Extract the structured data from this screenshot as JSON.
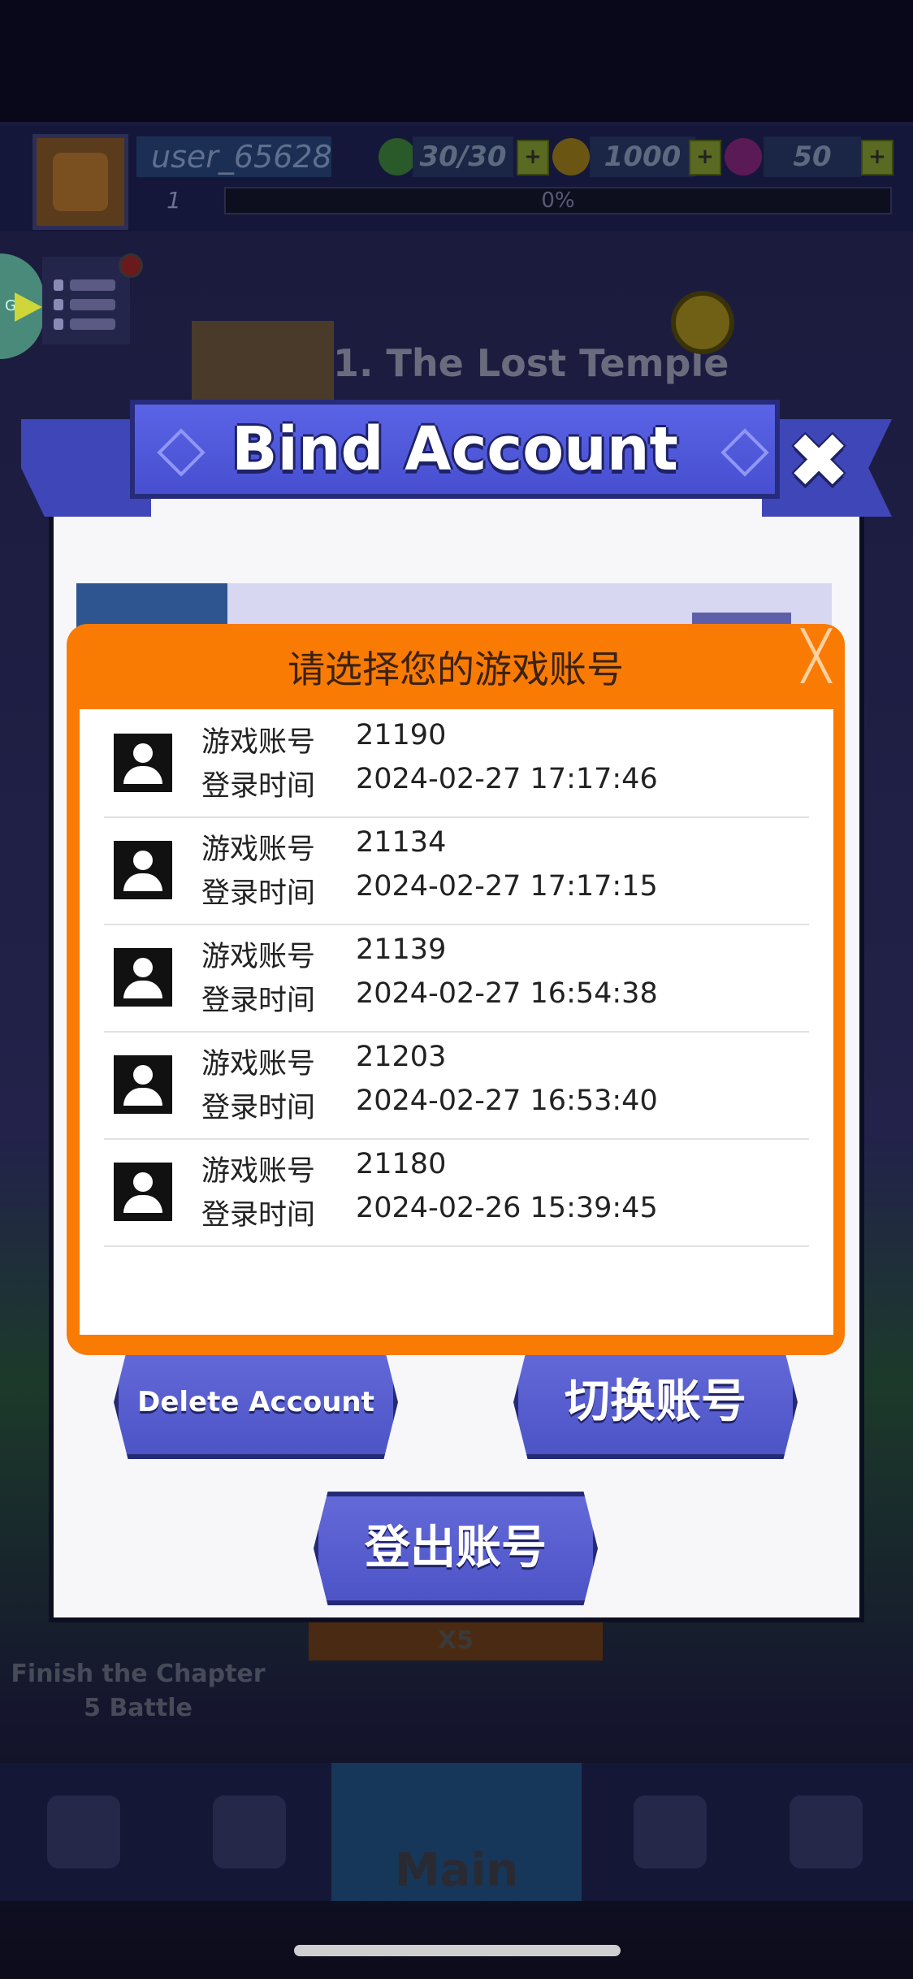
{
  "hud": {
    "username": "user_65628",
    "level": "1",
    "xp_percent": "0%",
    "energy": "30/30",
    "coins": "1000",
    "gems": "50",
    "gm_label": "GM",
    "chapter_title": "1. The Lost Temple",
    "mission_text": "Finish the Chapter 5 Battle",
    "reward_multiplier": "X5",
    "main_tab": "Main"
  },
  "bind_panel": {
    "title": "Bind Account",
    "delete_button": "Delete Account",
    "switch_button": "切换账号",
    "logout_button": "登出账号"
  },
  "popup": {
    "title": "请选择您的游戏账号",
    "account_label": "游戏账号",
    "login_time_label": "登录时间",
    "accounts": [
      {
        "id": "21190",
        "login_time": "2024-02-27 17:17:46"
      },
      {
        "id": "21134",
        "login_time": "2024-02-27 17:17:15"
      },
      {
        "id": "21139",
        "login_time": "2024-02-27 16:54:38"
      },
      {
        "id": "21203",
        "login_time": "2024-02-27 16:53:40"
      },
      {
        "id": "21180",
        "login_time": "2024-02-26 15:39:45"
      }
    ]
  },
  "colors": {
    "popup_orange": "#f97b04",
    "button_blue": "#5a61d6",
    "panel_bg": "#f7f7f9"
  }
}
